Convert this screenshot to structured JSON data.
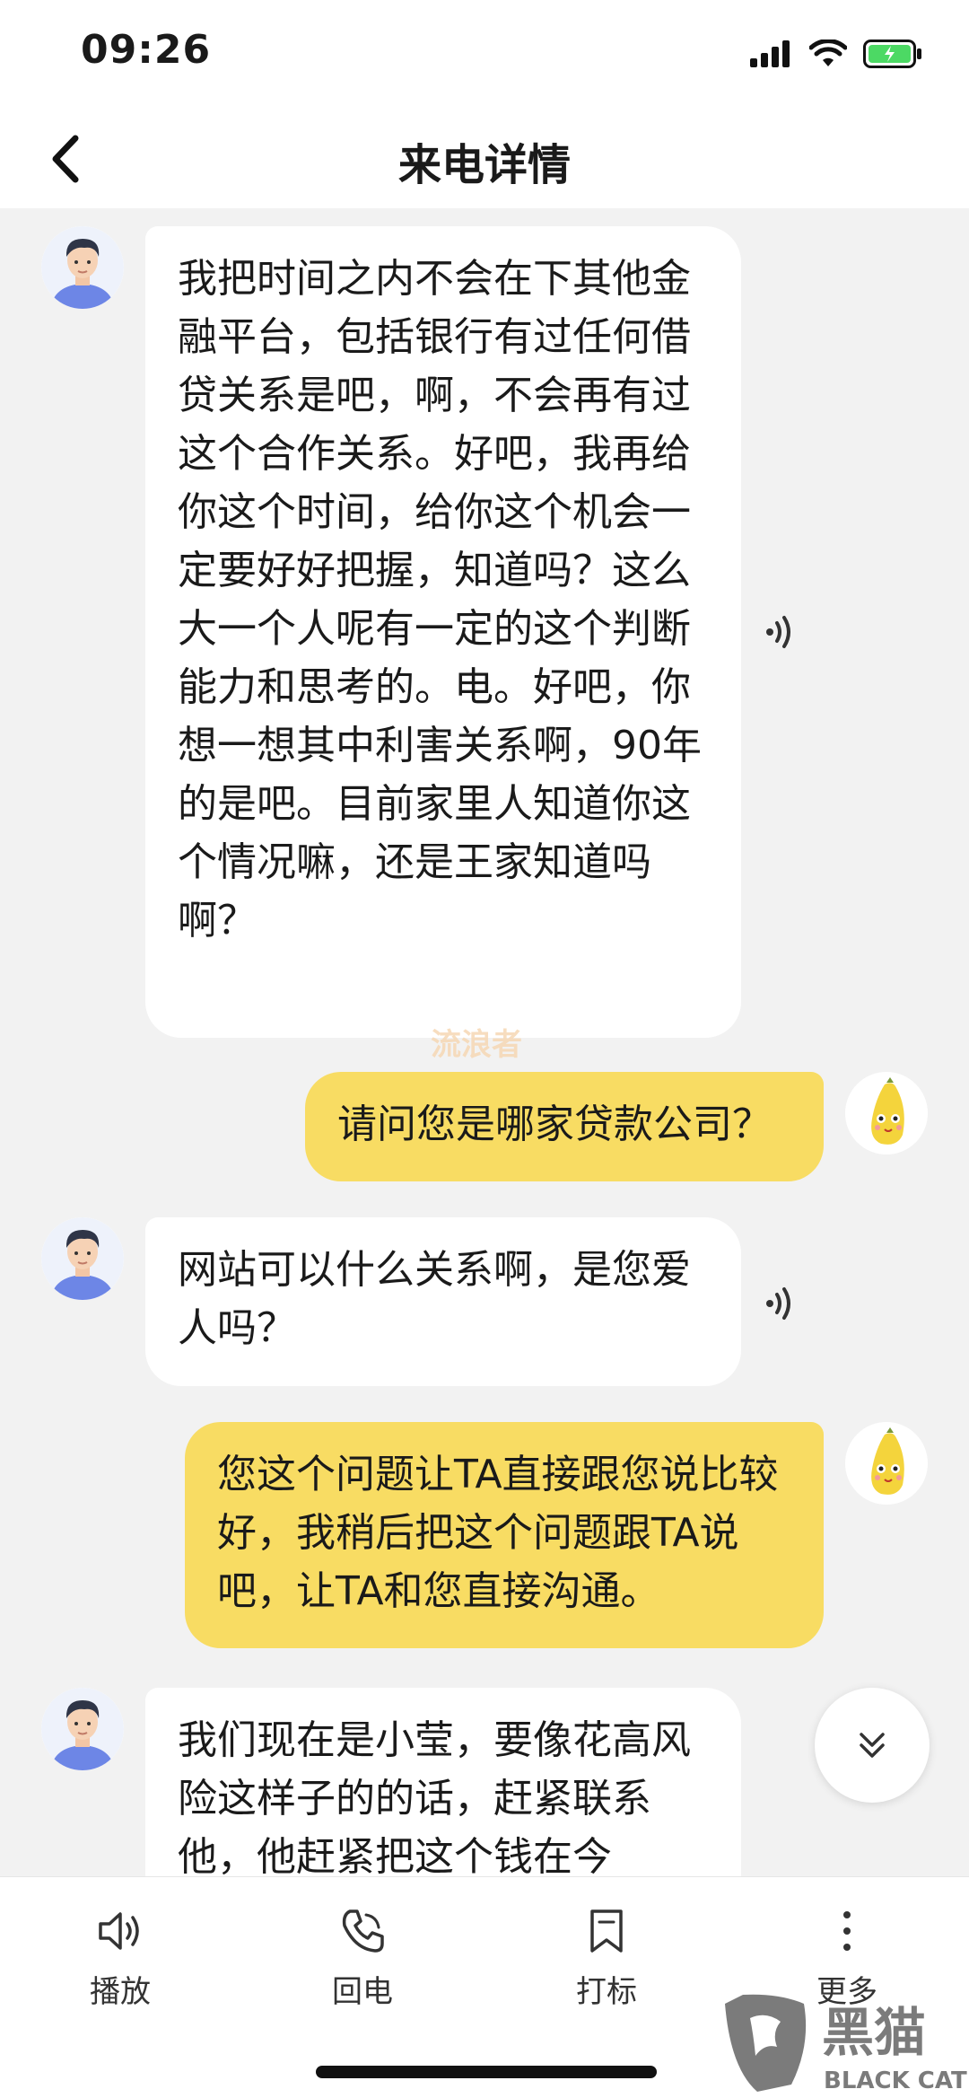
{
  "status_bar": {
    "time": "09:26"
  },
  "nav": {
    "title": "来电详情"
  },
  "messages": [
    {
      "side": "left",
      "text": "我把时间之内不会在下其他金融平台，包括银行有过任何借贷关系是吧，啊，不会再有过这个合作关系。好吧，我再给你这个时间，给你这个机会一定要好好把握，知道吗？这么大一个人呢有一定的这个判断能力和思考的。电。好吧，你想一想其中利害关系啊，90年的是吧。目前家里人知道你这个情况嘛，还是王家知道吗啊？"
    },
    {
      "side": "right",
      "text": "请问您是哪家贷款公司？"
    },
    {
      "side": "left",
      "text": "网站可以什么关系啊，是您爱人吗？"
    },
    {
      "side": "right",
      "text": "您这个问题让TA直接跟您说比较好，我稍后把这个问题跟TA说吧，让TA和您直接沟通。"
    },
    {
      "side": "left",
      "text": "我们现在是小莹，要像花高风险这样子的的话，赶紧联系他，他赶紧把这个钱在今"
    }
  ],
  "watermark": "流浪者",
  "toolbar": {
    "play": "播放",
    "callback": "回电",
    "mark": "打标",
    "more": "更多"
  },
  "brand": {
    "name": "黑猫",
    "sub": "BLACK CAT"
  },
  "colors": {
    "user_bubble": "#f8dc63",
    "caller_bubble": "#ffffff",
    "background": "#f2f2f2"
  }
}
